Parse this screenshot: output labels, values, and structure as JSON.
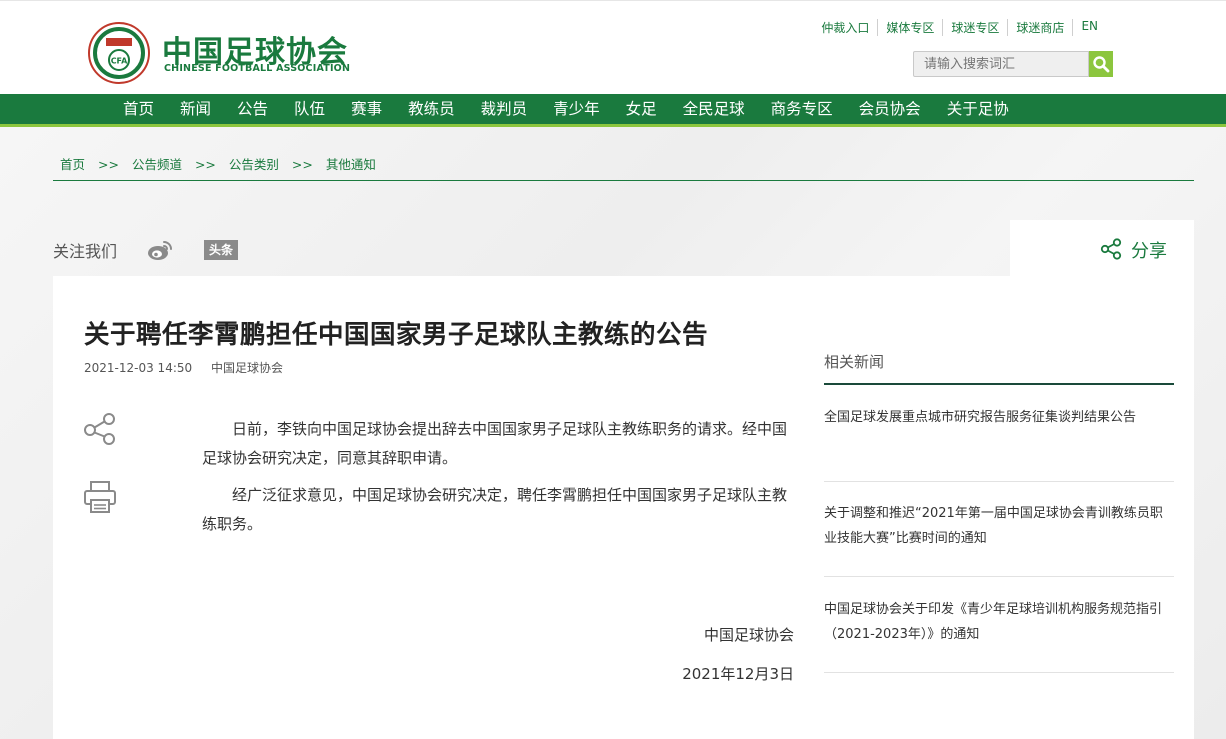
{
  "header": {
    "logo_cn": "中国足球协会",
    "logo_en": "CHINESE FOOTBALL ASSOCIATION",
    "emblem_text": "CFA",
    "top_links": [
      "仲裁入口",
      "媒体专区",
      "球迷专区",
      "球迷商店",
      "EN"
    ],
    "search_placeholder": "请输入搜索词汇"
  },
  "nav": [
    "首页",
    "新闻",
    "公告",
    "队伍",
    "赛事",
    "教练员",
    "裁判员",
    "青少年",
    "女足",
    "全民足球",
    "商务专区",
    "会员协会",
    "关于足协"
  ],
  "breadcrumb": [
    "首页",
    ">>",
    "公告频道",
    ">>",
    "公告类别",
    ">>",
    "其他通知"
  ],
  "social": {
    "follow_label": "关注我们",
    "toutiao_label": "头条",
    "share_label": "分享"
  },
  "article": {
    "title": "关于聘任李霄鹏担任中国国家男子足球队主教练的公告",
    "datetime": "2021-12-03 14:50",
    "source": "中国足球协会",
    "paragraphs": [
      "日前，李铁向中国足球协会提出辞去中国国家男子足球队主教练职务的请求。经中国足球协会研究决定，同意其辞职申请。",
      "经广泛征求意见，中国足球协会研究决定，聘任李霄鹏担任中国国家男子足球队主教练职务。"
    ],
    "signature": "中国足球协会",
    "date": "2021年12月3日"
  },
  "related": {
    "title": "相关新闻",
    "items": [
      "全国足球发展重点城市研究报告服务征集谈判结果公告",
      "关于调整和推迟“2021年第一届中国足球协会青训教练员职业技能大赛”比赛时间的通知",
      "中国足球协会关于印发《青少年足球培训机构服务规范指引（2021-2023年）》的通知"
    ]
  },
  "colors": {
    "brand_green": "#1a7a3e",
    "accent_lime": "#8cc63e"
  }
}
